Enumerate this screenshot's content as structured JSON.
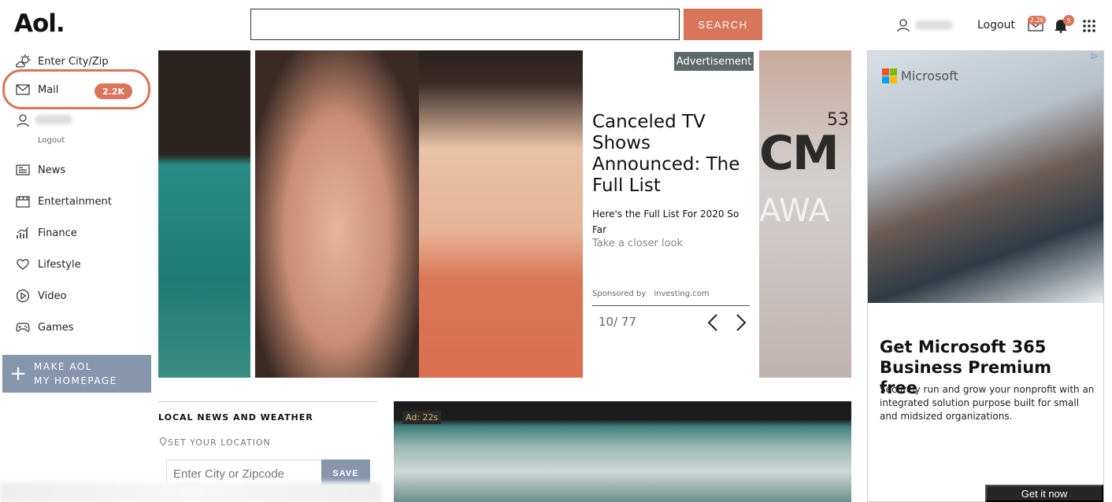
{
  "header": {
    "logo": "Aol.",
    "search_placeholder": "",
    "search_button": "SEARCH",
    "logout": "Logout",
    "mail_count": "2.2k",
    "notification_count": "5"
  },
  "sidebar": {
    "weather": "Enter City/Zip",
    "mail_label": "Mail",
    "mail_count": "2.2K",
    "logout": "Logout",
    "items": [
      {
        "label": "News",
        "icon": "news-icon"
      },
      {
        "label": "Entertainment",
        "icon": "clapperboard-icon"
      },
      {
        "label": "Finance",
        "icon": "chart-icon"
      },
      {
        "label": "Lifestyle",
        "icon": "heart-icon"
      },
      {
        "label": "Video",
        "icon": "play-icon"
      },
      {
        "label": "Games",
        "icon": "gamepad-icon"
      }
    ],
    "make_homepage_line1": "MAKE AOL",
    "make_homepage_line2": "MY HOMEPAGE"
  },
  "carousel": {
    "ad_label": "Advertisement",
    "title": "Canceled TV Shows Announced: The Full List",
    "subtitle": "Here's the Full List For 2020 So Far",
    "link": "Take a closer look",
    "sponsored_by": "Sponsored by",
    "sponsor": "investing.com",
    "counter": "10/ 77",
    "right_photo_text_1": "CM",
    "right_photo_text_2": "AWA",
    "right_photo_number": "53"
  },
  "local_news": {
    "title": "LOCAL NEWS AND WEATHER",
    "set_location": "SET YOUR LOCATION",
    "zip_placeholder": "Enter City or Zipcode",
    "save": "SAVE"
  },
  "video_ad": {
    "timer": "Ad: 22s"
  },
  "right_ad": {
    "brand": "Microsoft",
    "headline": "Get Microsoft 365 Business Premium free",
    "body": "Securely run and grow your nonprofit with an integrated solution purpose built for small and midsized organizations.",
    "cta": "Get it now"
  },
  "colors": {
    "accent": "#d9755a",
    "homepage_button": "#8596ad"
  }
}
